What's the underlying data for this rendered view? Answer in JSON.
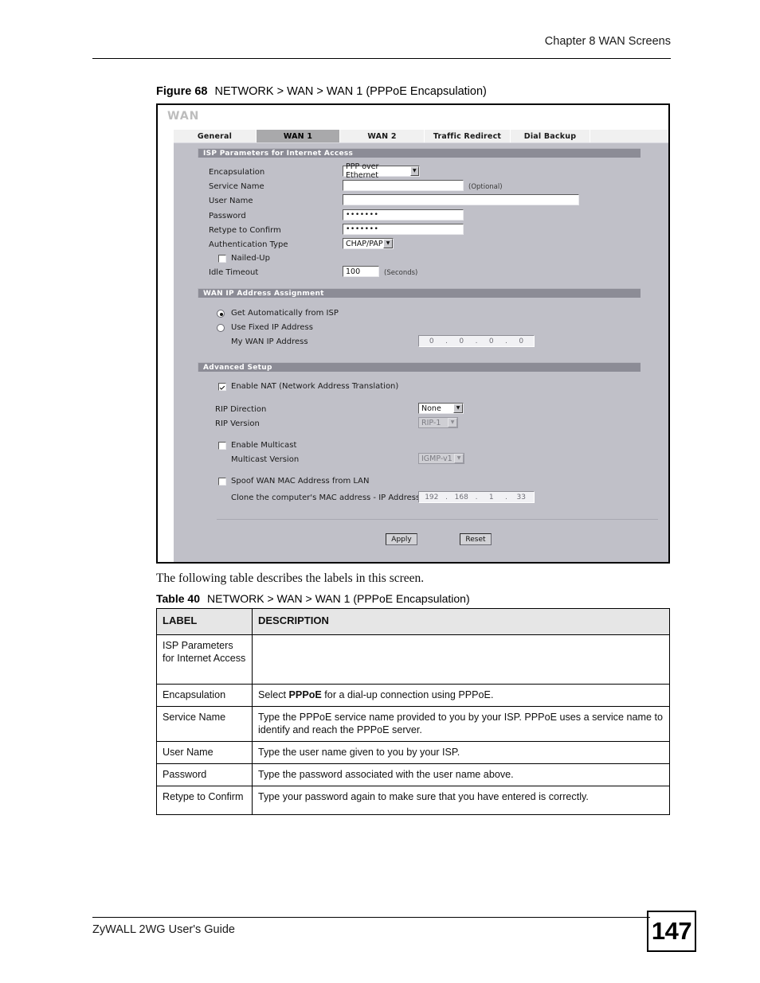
{
  "header": {
    "chapter": "Chapter 8 WAN Screens"
  },
  "footer": {
    "guide": "ZyWALL 2WG User's Guide",
    "page_number": "147"
  },
  "figure": {
    "label": "Figure 68",
    "title": "NETWORK > WAN > WAN 1 (PPPoE Encapsulation)"
  },
  "screen": {
    "title": "WAN",
    "tabs": [
      {
        "label": "General",
        "active": false
      },
      {
        "label": "WAN 1",
        "active": true
      },
      {
        "label": "WAN 2",
        "active": false
      },
      {
        "label": "Traffic Redirect",
        "active": false
      },
      {
        "label": "Dial Backup",
        "active": false
      }
    ],
    "sections": {
      "isp": {
        "header": "ISP Parameters for Internet Access",
        "encapsulation_label": "Encapsulation",
        "encapsulation_value": "PPP over Ethernet",
        "service_name_label": "Service Name",
        "service_name_value": "",
        "service_name_note": "(Optional)",
        "user_name_label": "User Name",
        "user_name_value": "",
        "password_label": "Password",
        "password_value": "•••••••",
        "retype_label": "Retype to Confirm",
        "retype_value": "•••••••",
        "auth_type_label": "Authentication Type",
        "auth_type_value": "CHAP/PAP",
        "nailed_up_label": "Nailed-Up",
        "nailed_up_checked": false,
        "idle_timeout_label": "Idle Timeout",
        "idle_timeout_value": "100",
        "idle_timeout_note": "(Seconds)"
      },
      "wan_ip": {
        "header": "WAN IP Address Assignment",
        "auto_label": "Get Automatically from ISP",
        "auto_selected": true,
        "fixed_label": "Use Fixed IP Address",
        "fixed_selected": false,
        "my_wan_ip_label": "My WAN IP Address",
        "my_wan_ip": [
          "0",
          "0",
          "0",
          "0"
        ]
      },
      "advanced": {
        "header": "Advanced Setup",
        "enable_nat_label": "Enable NAT (Network Address Translation)",
        "enable_nat_checked": true,
        "rip_direction_label": "RIP Direction",
        "rip_direction_value": "None",
        "rip_version_label": "RIP Version",
        "rip_version_value": "RIP-1",
        "enable_multicast_label": "Enable Multicast",
        "enable_multicast_checked": false,
        "multicast_version_label": "Multicast Version",
        "multicast_version_value": "IGMP-v1",
        "spoof_mac_label": "Spoof WAN MAC Address from LAN",
        "spoof_mac_checked": false,
        "clone_mac_label": "Clone the computer's MAC address - IP Address",
        "clone_mac_ip": [
          "192",
          "168",
          "1",
          "33"
        ]
      }
    },
    "buttons": {
      "apply": "Apply",
      "reset": "Reset"
    }
  },
  "prose": {
    "intro": "The following table describes the labels in this screen."
  },
  "table": {
    "label": "Table 40",
    "title": "NETWORK > WAN > WAN 1 (PPPoE Encapsulation)",
    "columns": [
      "LABEL",
      "DESCRIPTION"
    ],
    "rows": [
      {
        "label": "ISP Parameters for Internet Access",
        "description": ""
      },
      {
        "label": "Encapsulation",
        "description_pre": "Select ",
        "description_bold": "PPPoE",
        "description_post": " for a dial-up connection using PPPoE."
      },
      {
        "label": "Service Name",
        "description": "Type the PPPoE service name provided to you by your ISP. PPPoE uses a service name to identify and reach the PPPoE server."
      },
      {
        "label": "User Name",
        "description": "Type the user name given to you by your ISP."
      },
      {
        "label": "Password",
        "description": "Type the password associated with the user name above."
      },
      {
        "label": "Retype to Confirm",
        "description": "Type your password again to make sure that you have entered is correctly."
      }
    ]
  },
  "colors": {
    "panel_bg": "#c0c0c8",
    "section_bar": "#8c8c96",
    "tab_inactive": "#f0f0f0",
    "tab_active": "#a9a9ab",
    "table_header_bg": "#e6e6e6"
  }
}
